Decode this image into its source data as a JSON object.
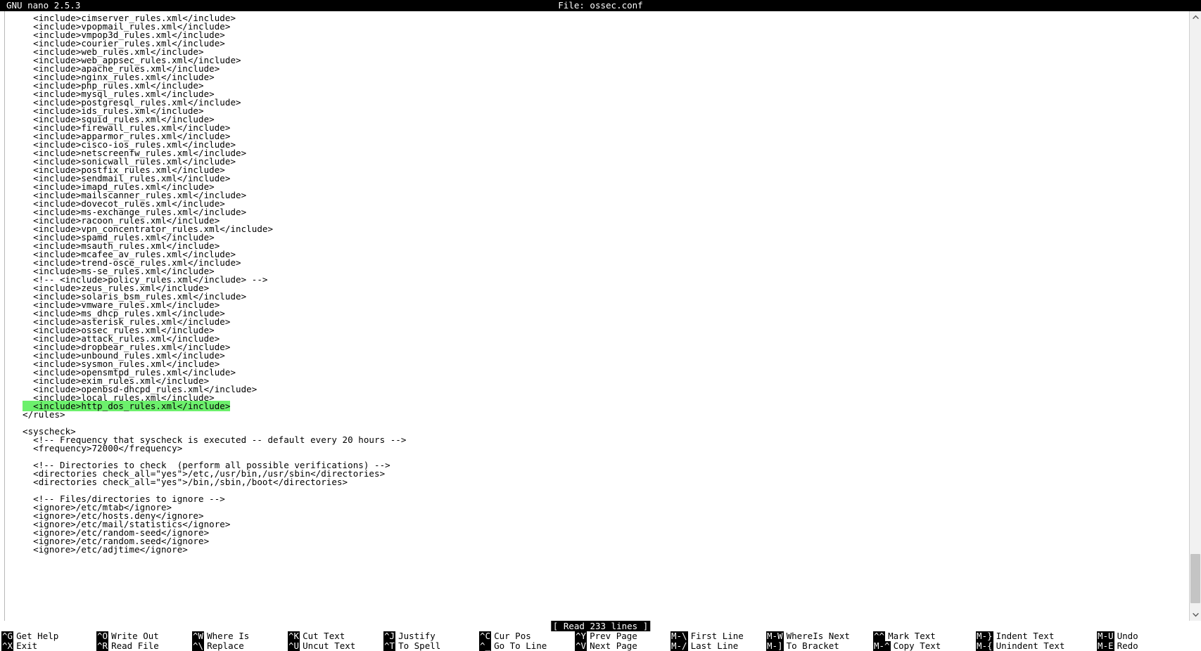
{
  "titlebar": {
    "app": "GNU nano 2.5.3",
    "file_label": "File: ossec.conf"
  },
  "editor": {
    "lines": [
      {
        "text": "  <include>cimserver_rules.xml</include>",
        "highlight": false
      },
      {
        "text": "  <include>vpopmail_rules.xml</include>",
        "highlight": false
      },
      {
        "text": "  <include>vmpop3d_rules.xml</include>",
        "highlight": false
      },
      {
        "text": "  <include>courier_rules.xml</include>",
        "highlight": false
      },
      {
        "text": "  <include>web_rules.xml</include>",
        "highlight": false
      },
      {
        "text": "  <include>web_appsec_rules.xml</include>",
        "highlight": false
      },
      {
        "text": "  <include>apache_rules.xml</include>",
        "highlight": false
      },
      {
        "text": "  <include>nginx_rules.xml</include>",
        "highlight": false
      },
      {
        "text": "  <include>php_rules.xml</include>",
        "highlight": false
      },
      {
        "text": "  <include>mysql_rules.xml</include>",
        "highlight": false
      },
      {
        "text": "  <include>postgresql_rules.xml</include>",
        "highlight": false
      },
      {
        "text": "  <include>ids_rules.xml</include>",
        "highlight": false
      },
      {
        "text": "  <include>squid_rules.xml</include>",
        "highlight": false
      },
      {
        "text": "  <include>firewall_rules.xml</include>",
        "highlight": false
      },
      {
        "text": "  <include>apparmor_rules.xml</include>",
        "highlight": false
      },
      {
        "text": "  <include>cisco-ios_rules.xml</include>",
        "highlight": false
      },
      {
        "text": "  <include>netscreenfw_rules.xml</include>",
        "highlight": false
      },
      {
        "text": "  <include>sonicwall_rules.xml</include>",
        "highlight": false
      },
      {
        "text": "  <include>postfix_rules.xml</include>",
        "highlight": false
      },
      {
        "text": "  <include>sendmail_rules.xml</include>",
        "highlight": false
      },
      {
        "text": "  <include>imapd_rules.xml</include>",
        "highlight": false
      },
      {
        "text": "  <include>mailscanner_rules.xml</include>",
        "highlight": false
      },
      {
        "text": "  <include>dovecot_rules.xml</include>",
        "highlight": false
      },
      {
        "text": "  <include>ms-exchange_rules.xml</include>",
        "highlight": false
      },
      {
        "text": "  <include>racoon_rules.xml</include>",
        "highlight": false
      },
      {
        "text": "  <include>vpn_concentrator_rules.xml</include>",
        "highlight": false
      },
      {
        "text": "  <include>spamd_rules.xml</include>",
        "highlight": false
      },
      {
        "text": "  <include>msauth_rules.xml</include>",
        "highlight": false
      },
      {
        "text": "  <include>mcafee_av_rules.xml</include>",
        "highlight": false
      },
      {
        "text": "  <include>trend-osce_rules.xml</include>",
        "highlight": false
      },
      {
        "text": "  <include>ms-se_rules.xml</include>",
        "highlight": false
      },
      {
        "text": "  <!-- <include>policy_rules.xml</include> -->",
        "highlight": false
      },
      {
        "text": "  <include>zeus_rules.xml</include>",
        "highlight": false
      },
      {
        "text": "  <include>solaris_bsm_rules.xml</include>",
        "highlight": false
      },
      {
        "text": "  <include>vmware_rules.xml</include>",
        "highlight": false
      },
      {
        "text": "  <include>ms_dhcp_rules.xml</include>",
        "highlight": false
      },
      {
        "text": "  <include>asterisk_rules.xml</include>",
        "highlight": false
      },
      {
        "text": "  <include>ossec_rules.xml</include>",
        "highlight": false
      },
      {
        "text": "  <include>attack_rules.xml</include>",
        "highlight": false
      },
      {
        "text": "  <include>dropbear_rules.xml</include>",
        "highlight": false
      },
      {
        "text": "  <include>unbound_rules.xml</include>",
        "highlight": false
      },
      {
        "text": "  <include>sysmon_rules.xml</include>",
        "highlight": false
      },
      {
        "text": "  <include>opensmtpd_rules.xml</include>",
        "highlight": false
      },
      {
        "text": "  <include>exim_rules.xml</include>",
        "highlight": false
      },
      {
        "text": "  <include>openbsd-dhcpd_rules.xml</include>",
        "highlight": false
      },
      {
        "text": "  <include>local_rules.xml</include>",
        "highlight": false
      },
      {
        "text": "  <include>http_dos_rules.xml</include>",
        "highlight": true
      },
      {
        "text": "</rules>",
        "highlight": false
      },
      {
        "text": "",
        "highlight": false
      },
      {
        "text": "<syscheck>",
        "highlight": false
      },
      {
        "text": "  <!-- Frequency that syscheck is executed -- default every 20 hours -->",
        "highlight": false
      },
      {
        "text": "  <frequency>72000</frequency>",
        "highlight": false
      },
      {
        "text": "",
        "highlight": false
      },
      {
        "text": "  <!-- Directories to check  (perform all possible verifications) -->",
        "highlight": false
      },
      {
        "text": "  <directories check_all=\"yes\">/etc,/usr/bin,/usr/sbin</directories>",
        "highlight": false
      },
      {
        "text": "  <directories check_all=\"yes\">/bin,/sbin,/boot</directories>",
        "highlight": false
      },
      {
        "text": "",
        "highlight": false
      },
      {
        "text": "  <!-- Files/directories to ignore -->",
        "highlight": false
      },
      {
        "text": "  <ignore>/etc/mtab</ignore>",
        "highlight": false
      },
      {
        "text": "  <ignore>/etc/hosts.deny</ignore>",
        "highlight": false
      },
      {
        "text": "  <ignore>/etc/mail/statistics</ignore>",
        "highlight": false
      },
      {
        "text": "  <ignore>/etc/random-seed</ignore>",
        "highlight": false
      },
      {
        "text": "  <ignore>/etc/random.seed</ignore>",
        "highlight": false
      },
      {
        "text": "  <ignore>/etc/adjtime</ignore>",
        "highlight": false
      }
    ],
    "highlight_color": "#6cf06c"
  },
  "status": {
    "message": "[ Read 233 lines ]"
  },
  "shortcuts": [
    {
      "top_key": "^G",
      "top_label": "Get Help",
      "bottom_key": "^X",
      "bottom_label": "Exit"
    },
    {
      "top_key": "^O",
      "top_label": "Write Out",
      "bottom_key": "^R",
      "bottom_label": "Read File"
    },
    {
      "top_key": "^W",
      "top_label": "Where Is",
      "bottom_key": "^\\",
      "bottom_label": "Replace"
    },
    {
      "top_key": "^K",
      "top_label": "Cut Text",
      "bottom_key": "^U",
      "bottom_label": "Uncut Text"
    },
    {
      "top_key": "^J",
      "top_label": "Justify",
      "bottom_key": "^T",
      "bottom_label": "To Spell"
    },
    {
      "top_key": "^C",
      "top_label": "Cur Pos",
      "bottom_key": "^_",
      "bottom_label": "Go To Line"
    },
    {
      "top_key": "^Y",
      "top_label": "Prev Page",
      "bottom_key": "^V",
      "bottom_label": "Next Page"
    },
    {
      "top_key": "M-\\",
      "top_label": "First Line",
      "bottom_key": "M-/",
      "bottom_label": "Last Line"
    },
    {
      "top_key": "M-W",
      "top_label": "WhereIs Next",
      "bottom_key": "M-]",
      "bottom_label": "To Bracket"
    },
    {
      "top_key": "^^",
      "top_label": "Mark Text",
      "bottom_key": "M-^",
      "bottom_label": "Copy Text"
    },
    {
      "top_key": "M-}",
      "top_label": "Indent Text",
      "bottom_key": "M-{",
      "bottom_label": "Unindent Text"
    },
    {
      "top_key": "M-U",
      "top_label": "Undo",
      "bottom_key": "M-E",
      "bottom_label": "Redo"
    }
  ],
  "scrollbar": {
    "up_arrow": "chevron-up-icon",
    "down_arrow": "chevron-down-icon"
  }
}
